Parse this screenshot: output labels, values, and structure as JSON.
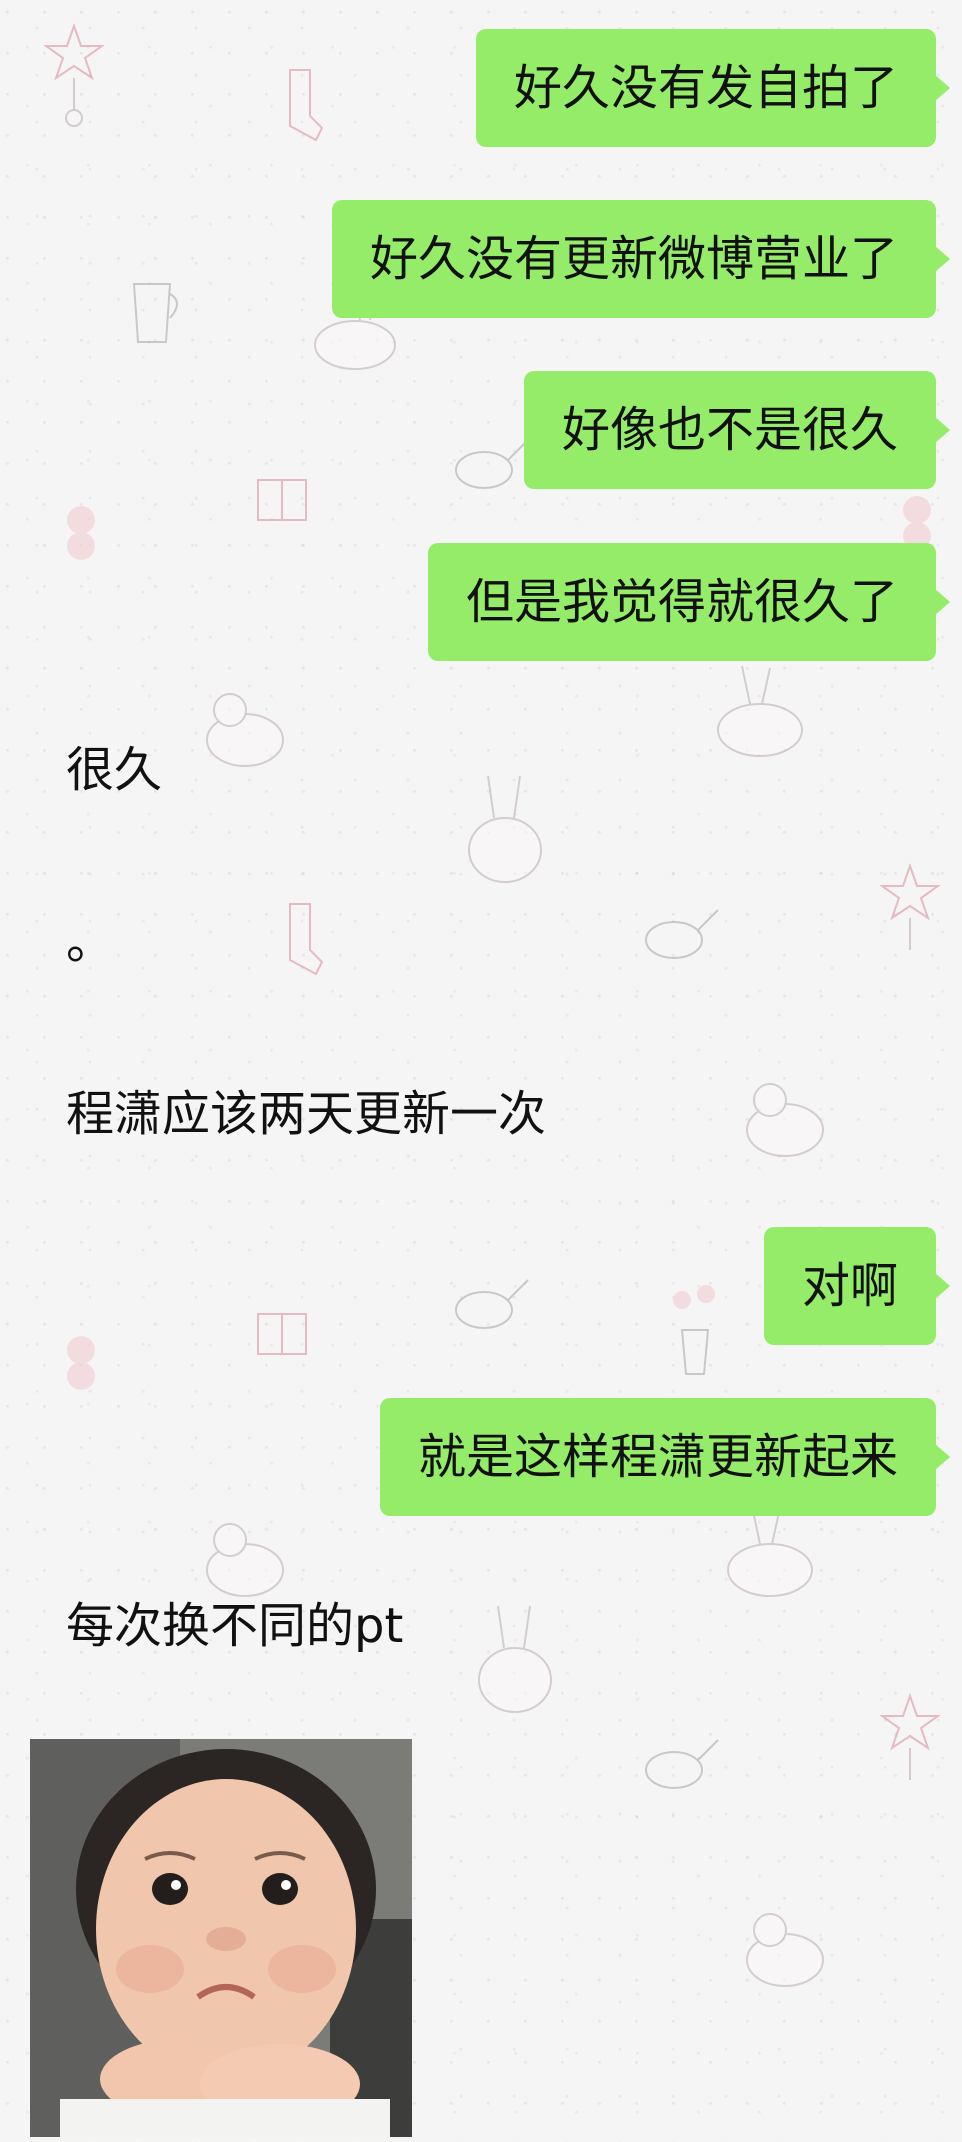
{
  "messages": [
    {
      "side": "sent",
      "text": "好久没有发自拍了"
    },
    {
      "side": "sent",
      "text": "好久没有更新微博营业了"
    },
    {
      "side": "sent",
      "text": "好像也不是很久"
    },
    {
      "side": "sent",
      "text": "但是我觉得就很久了"
    },
    {
      "side": "received",
      "text": "很久"
    },
    {
      "side": "received",
      "text": "。"
    },
    {
      "side": "received",
      "text": "程潇应该两天更新一次"
    },
    {
      "side": "sent",
      "text": "对啊"
    },
    {
      "side": "sent",
      "text": "就是这样程潇更新起来"
    },
    {
      "side": "received",
      "text": "每次换不同的pt"
    },
    {
      "side": "received",
      "image": "baby-sticker-image"
    }
  ],
  "colors": {
    "sent_bubble": "#95ec69",
    "text": "#111111",
    "wallpaper": "#f6f5f5"
  }
}
